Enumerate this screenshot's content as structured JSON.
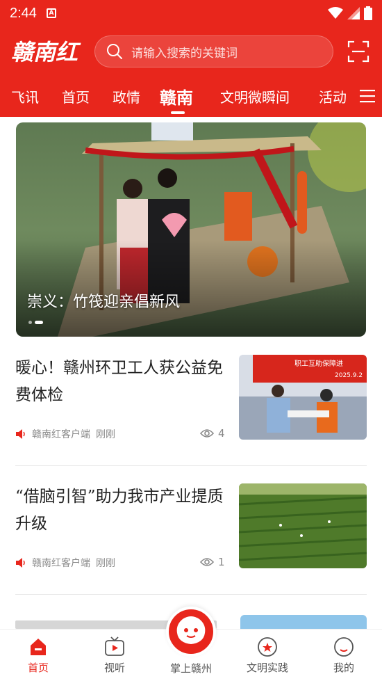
{
  "status_bar": {
    "time": "2:44"
  },
  "header": {
    "logo_text": "赣南红",
    "search_placeholder": "请输入搜索的关键词"
  },
  "tabs": [
    "飞讯",
    "首页",
    "政情",
    "赣南",
    "文明微瞬间",
    "活动"
  ],
  "active_tab": "赣南",
  "banner": {
    "title": "崇义：竹筏迎亲倡新风"
  },
  "articles": [
    {
      "title": "暖心！赣州环卫工人获公益免费体检",
      "source": "赣南红客户端",
      "time": "刚刚",
      "views": "4",
      "thumb_caption": "职工互助保障进",
      "thumb_date": "2025.9.2"
    },
    {
      "title": "“借脑引智”助力我市产业提质升级",
      "source": "赣南红客户端",
      "time": "刚刚",
      "views": "1"
    }
  ],
  "bottom_nav": {
    "items": [
      {
        "label": "首页",
        "icon": "home-icon"
      },
      {
        "label": "视听",
        "icon": "tv-icon"
      },
      {
        "label": "掌上赣州",
        "icon": "mascot-icon"
      },
      {
        "label": "文明实践",
        "icon": "badge-icon"
      },
      {
        "label": "我的",
        "icon": "profile-icon"
      }
    ],
    "active": "首页"
  },
  "colors": {
    "brand_red": "#e8261c"
  }
}
